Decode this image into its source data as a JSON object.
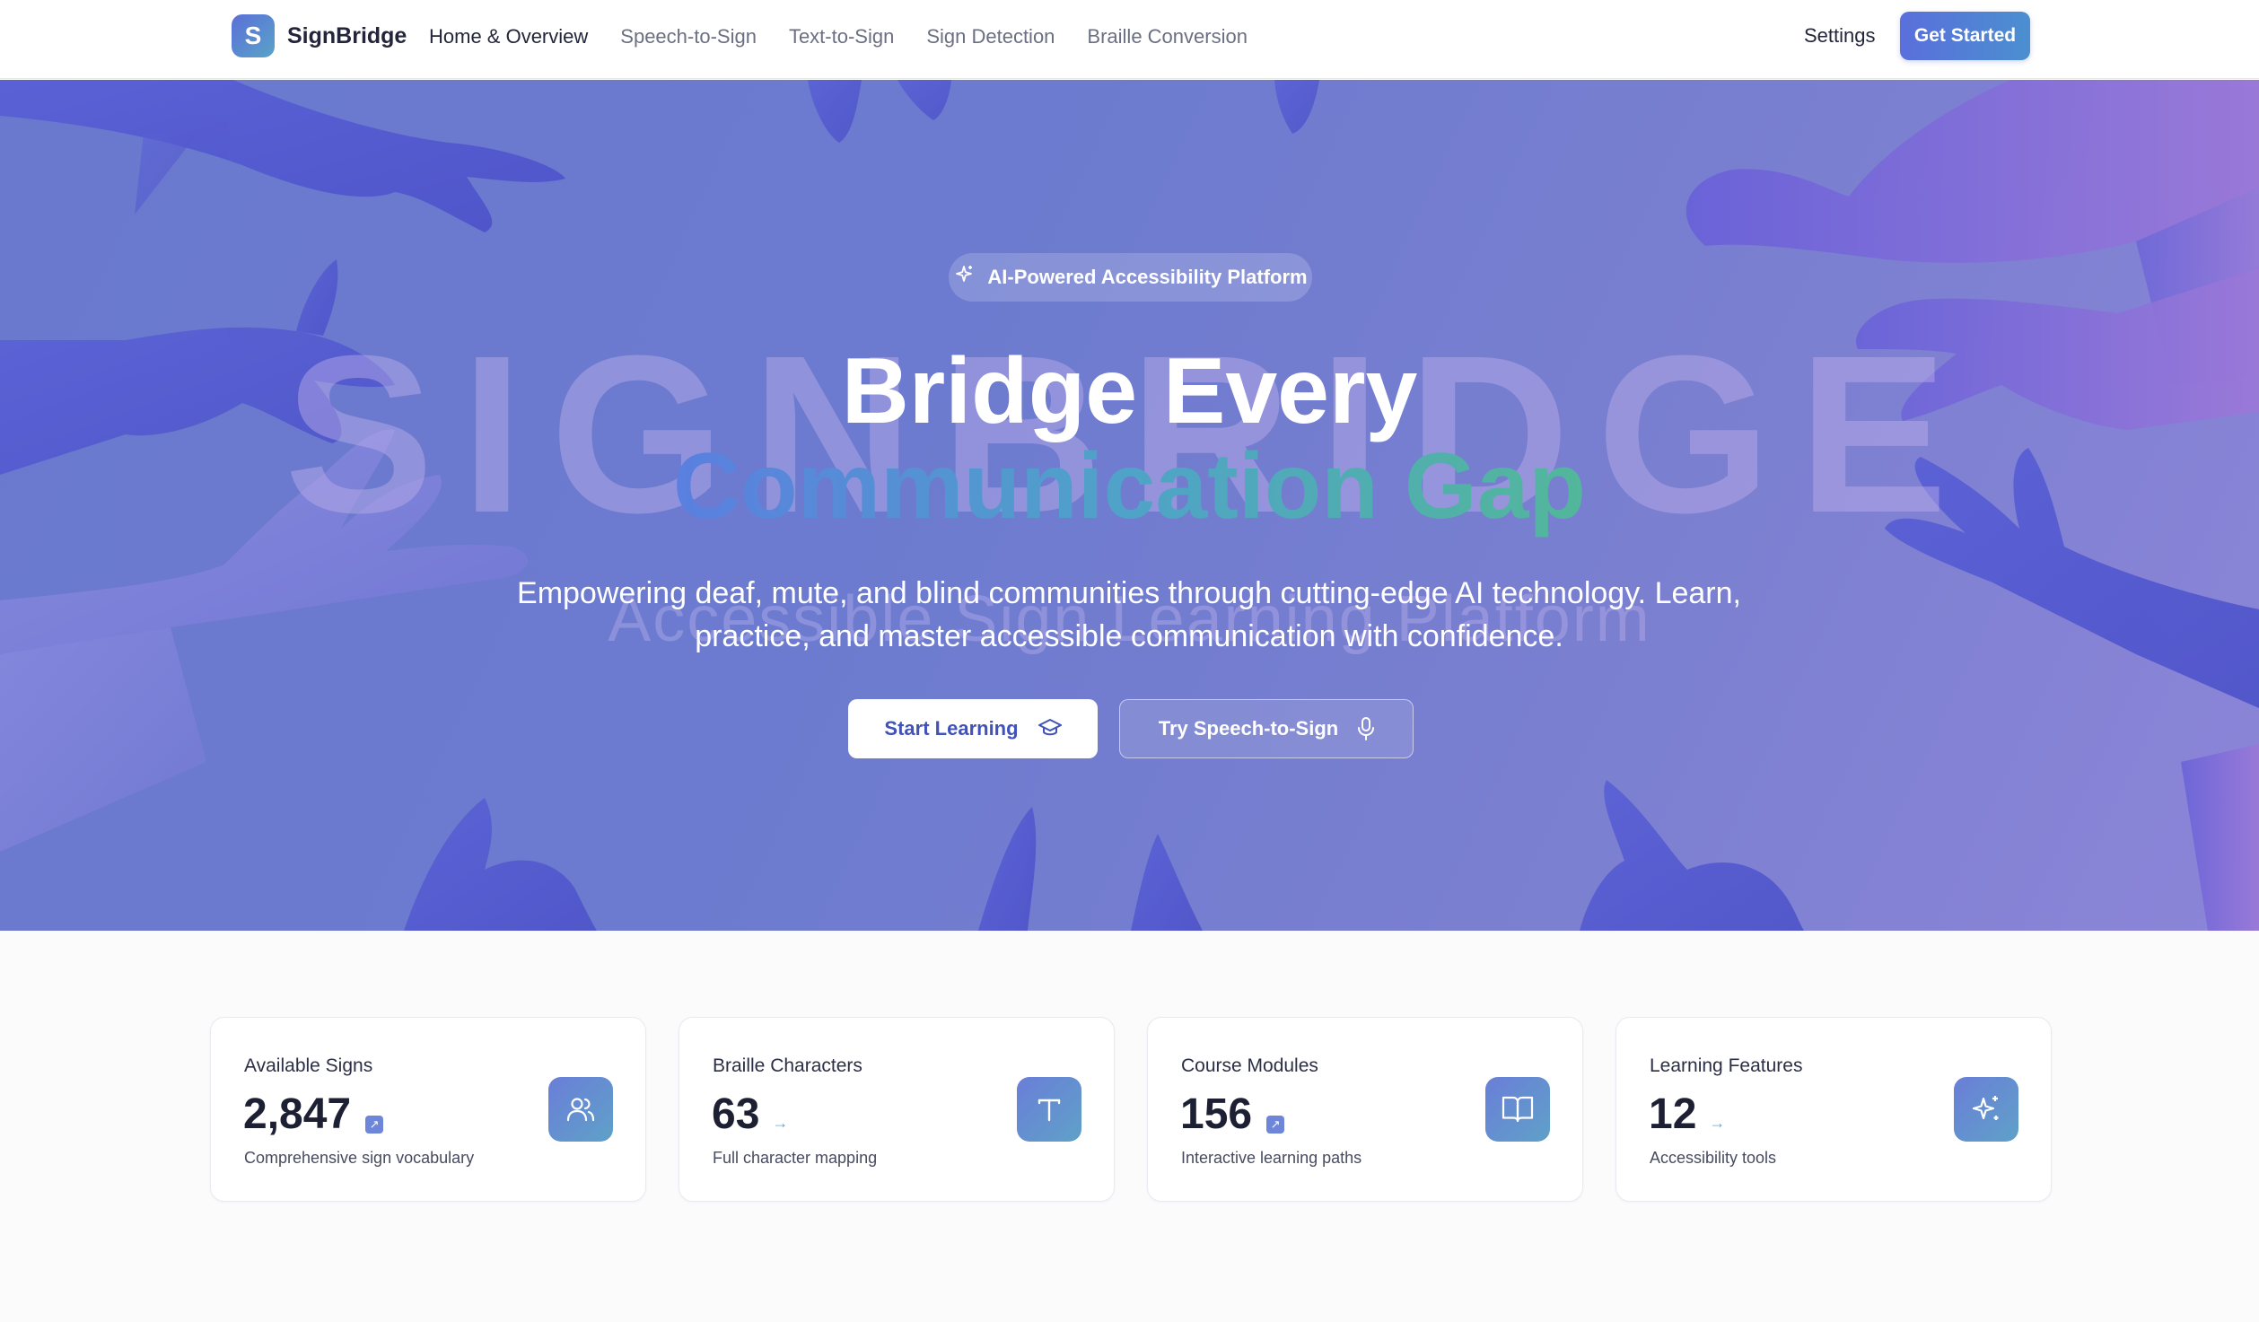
{
  "brand": {
    "logo_letter": "S",
    "name": "SignBridge"
  },
  "nav": {
    "links": [
      "Home & Overview",
      "Speech-to-Sign",
      "Text-to-Sign",
      "Sign Detection",
      "Braille Conversion"
    ],
    "active_index": 0,
    "settings": "Settings",
    "cta": "Get Started"
  },
  "hero": {
    "background_word": "SIGNBRIDGE",
    "background_tagline": "Accessible Sign Learning Platform",
    "badge": "AI-Powered Accessibility Platform",
    "title_line1": "Bridge Every",
    "title_line2": "Communication Gap",
    "subtitle": "Empowering deaf, mute, and blind communities through cutting-edge AI technology. Learn, practice, and master accessible communication with confidence.",
    "primary_button": "Start Learning",
    "secondary_button": "Try Speech-to-Sign"
  },
  "stats": [
    {
      "label": "Available Signs",
      "value": "2,847",
      "trend": "up",
      "desc": "Comprehensive sign vocabulary",
      "icon": "users-icon"
    },
    {
      "label": "Braille Characters",
      "value": "63",
      "trend": "flat",
      "desc": "Full character mapping",
      "icon": "text-icon"
    },
    {
      "label": "Course Modules",
      "value": "156",
      "trend": "up",
      "desc": "Interactive learning paths",
      "icon": "book-icon"
    },
    {
      "label": "Learning Features",
      "value": "12",
      "trend": "flat",
      "desc": "Accessibility tools",
      "icon": "sparkles-icon"
    }
  ],
  "colors": {
    "accent": "#5a6fdc",
    "hero_bg": "#6c7bcf",
    "gradient_start": "#5a7fe0",
    "gradient_end": "#52b79a"
  }
}
